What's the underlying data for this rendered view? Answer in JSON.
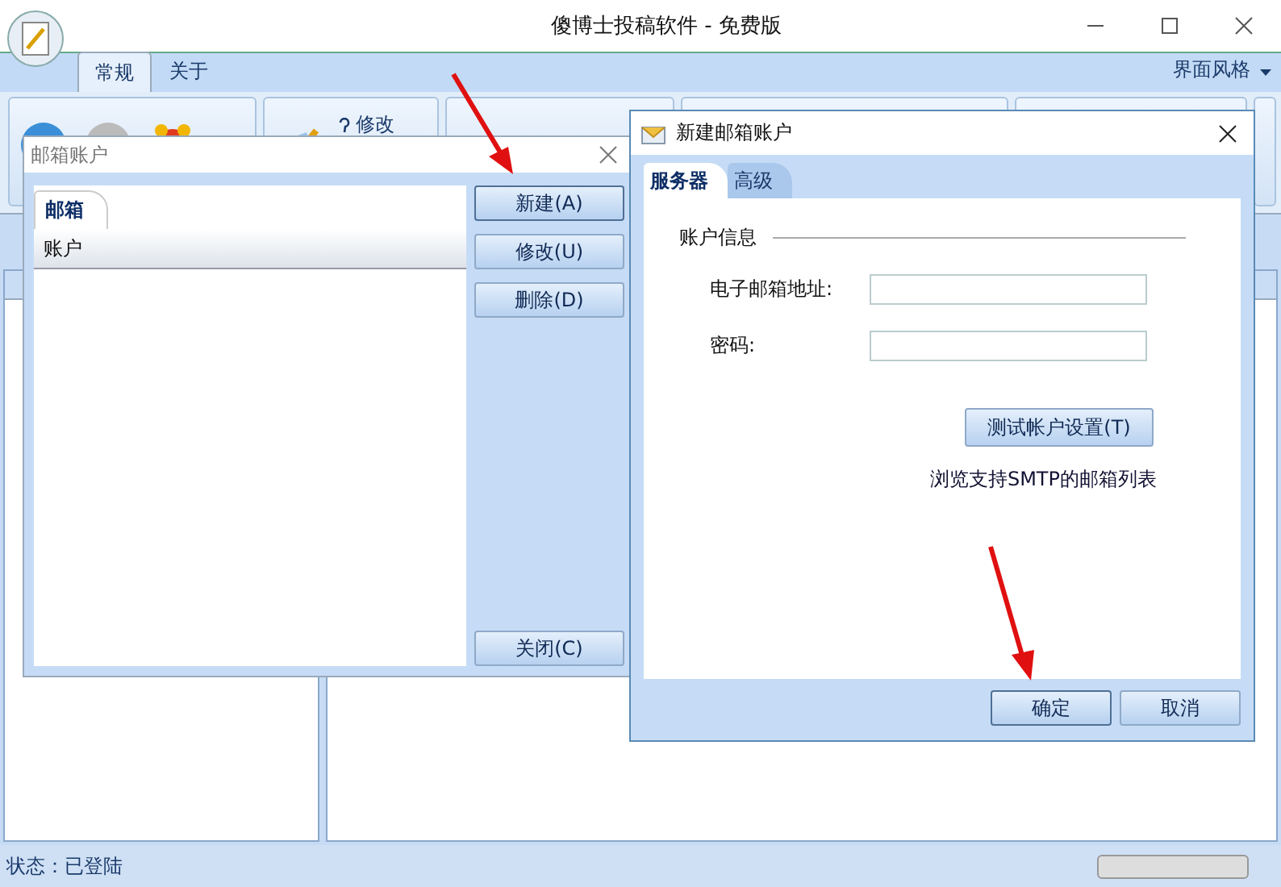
{
  "window": {
    "title": "傻博士投稿软件 - 免费版"
  },
  "menu_tabs": [
    {
      "label": "常规",
      "selected": true
    },
    {
      "label": "关于",
      "selected": false
    }
  ],
  "style_menu": {
    "label": "界面风格"
  },
  "toolbar": {
    "label": "修改"
  },
  "status_bar": {
    "text": "状态：已登陆",
    "level": 0
  },
  "mailbox_dialog": {
    "title": "邮箱账户",
    "tab": {
      "label": "邮箱",
      "selected": true
    },
    "column": "账户",
    "buttons": [
      {
        "label": "新建(A)",
        "default": true
      },
      {
        "label": "修改(U)",
        "default": false
      },
      {
        "label": "删除(D)",
        "default": false
      }
    ],
    "close_button": "关闭(C)"
  },
  "new_account_dialog": {
    "title": "新建邮箱账户",
    "tabs": [
      {
        "label": "服务器",
        "selected": true
      },
      {
        "label": "高级",
        "selected": false
      }
    ],
    "section": "账户信息",
    "fields": [
      {
        "label": "电子邮箱地址:"
      },
      {
        "label": "密码:"
      }
    ],
    "test_button": "测试帐户设置(T)",
    "link": "浏览支持SMTP的邮箱列表",
    "buttons": [
      {
        "label": "确定",
        "default": true
      },
      {
        "label": "取消",
        "default": false
      }
    ]
  }
}
